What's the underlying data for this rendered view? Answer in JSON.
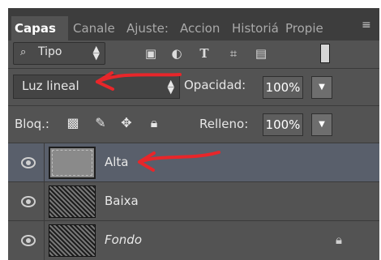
{
  "tabs": [
    {
      "label": "Capas",
      "active": true
    },
    {
      "label": "Canale",
      "active": false
    },
    {
      "label": "Ajuste:",
      "active": false
    },
    {
      "label": "Accion",
      "active": false
    },
    {
      "label": "Historiá",
      "active": false
    },
    {
      "label": "Propie",
      "active": false
    }
  ],
  "panel_menu_glyph": "≡",
  "filter": {
    "label": "Tipo",
    "icons": [
      "image-filter-icon",
      "adjustment-filter-icon",
      "type-filter-icon",
      "shape-filter-icon",
      "smart-object-filter-icon"
    ]
  },
  "blend": {
    "mode": "Luz lineal",
    "opacity_label": "Opacidad:",
    "opacity_value": "100%"
  },
  "lock": {
    "label": "Bloq.:",
    "fill_label": "Relleno:",
    "fill_value": "100%"
  },
  "layers": [
    {
      "name": "Alta",
      "selected": true,
      "italic": false,
      "thumbnail": "plain"
    },
    {
      "name": "Baixa",
      "selected": false,
      "italic": false,
      "thumbnail": "photo"
    },
    {
      "name": "Fondo",
      "selected": false,
      "italic": true,
      "thumbnail": "photo",
      "locked": true
    }
  ],
  "colors": {
    "panel": "#535353",
    "tabbar": "#3d3d3d",
    "selected_row": "#595f6b",
    "annotation": "#e8262a"
  }
}
